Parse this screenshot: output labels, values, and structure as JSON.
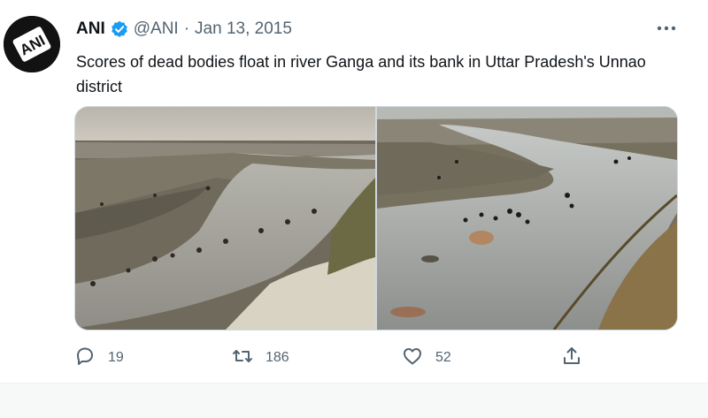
{
  "tweet": {
    "display_name": "ANI",
    "avatar_text": "ANI",
    "handle": "@ANI",
    "separator": "·",
    "date": "Jan 13, 2015",
    "text": "Scores of dead bodies float in river Ganga and its bank in Uttar Pradesh's Unnao district",
    "verified": true
  },
  "actions": {
    "reply_count": "19",
    "retweet_count": "186",
    "like_count": "52"
  },
  "colors": {
    "text_primary": "#0f1419",
    "text_secondary": "#536471",
    "verified_blue": "#1d9bf0"
  },
  "icons": {
    "verified": "verified-badge-icon",
    "more": "more-options-icon",
    "reply": "reply-icon",
    "retweet": "retweet-icon",
    "like": "like-icon",
    "share": "share-icon"
  }
}
